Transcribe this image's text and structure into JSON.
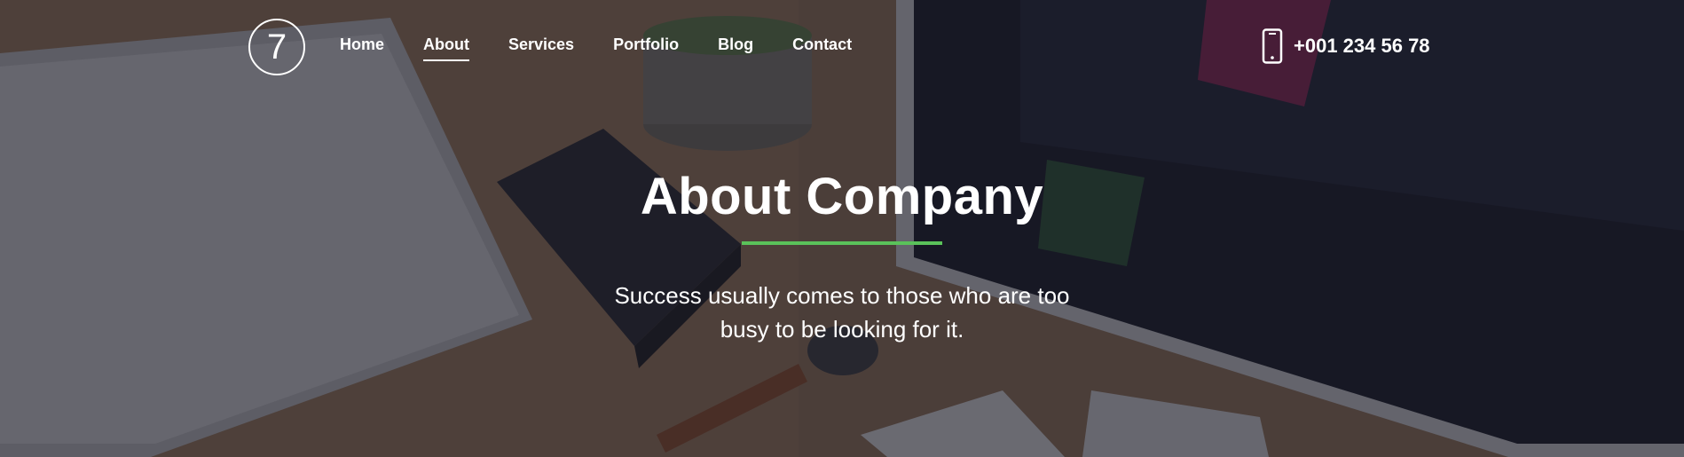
{
  "header": {
    "logo_text": "7",
    "nav": [
      {
        "label": "Home",
        "active": false
      },
      {
        "label": "About",
        "active": true
      },
      {
        "label": "Services",
        "active": false
      },
      {
        "label": "Portfolio",
        "active": false
      },
      {
        "label": "Blog",
        "active": false
      },
      {
        "label": "Contact",
        "active": false
      }
    ],
    "phone": {
      "number": "+001 234 56 78",
      "icon": "smartphone-icon"
    }
  },
  "hero": {
    "title": "About Company",
    "subtitle": "Success usually comes to those who are too busy to be looking for it.",
    "accent_color": "#5ac25a"
  }
}
